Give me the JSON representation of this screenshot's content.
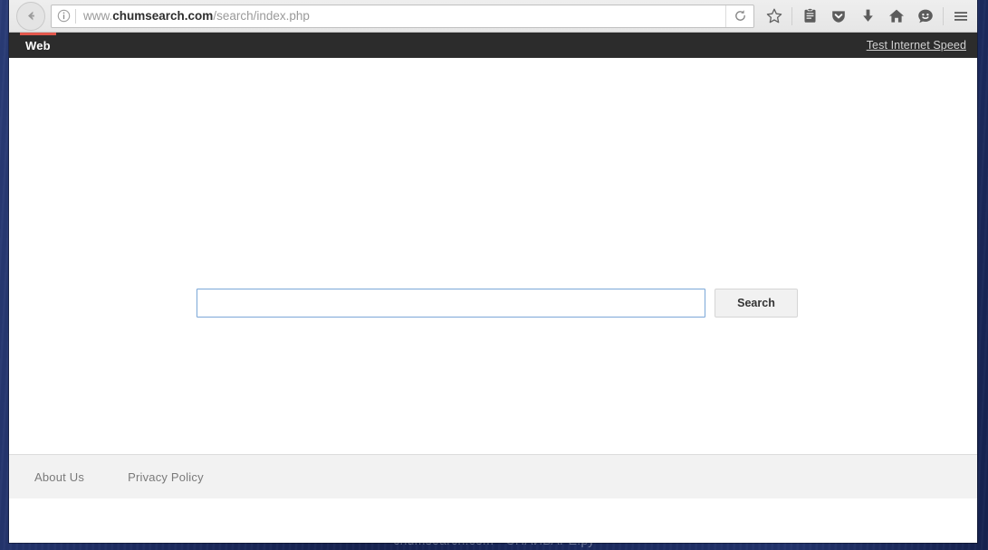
{
  "browser": {
    "back_button": "back-arrow",
    "identity_icon": "info-icon",
    "url": {
      "prefix": "www.",
      "host": "chumsearch.com",
      "path": "/search/index.php",
      "full": "www.chumsearch.com/search/index.php"
    },
    "reload_label": "reload-icon",
    "toolbar_icons": [
      {
        "name": "bookmark-star-icon",
        "glyph": "star"
      },
      {
        "name": "reader-list-icon",
        "glyph": "list"
      },
      {
        "name": "pocket-shield-icon",
        "glyph": "shield"
      },
      {
        "name": "downloads-arrow-icon",
        "glyph": "download"
      },
      {
        "name": "home-icon",
        "glyph": "home"
      },
      {
        "name": "chat-smiley-icon",
        "glyph": "smiley"
      },
      {
        "name": "menu-hamburger-icon",
        "glyph": "hamburger"
      }
    ]
  },
  "site": {
    "tab_label": "Web",
    "accent_color": "#e2574c",
    "header_bg": "#2c2c2c",
    "speed_link": "Test Internet Speed",
    "search": {
      "value": "",
      "placeholder": "",
      "button_label": "Search"
    },
    "footer_links": [
      {
        "label": "About Us"
      },
      {
        "label": "Privacy Policy"
      }
    ]
  },
  "watermark": "chumsearch.com - СПАЙВАРЕ.ру"
}
